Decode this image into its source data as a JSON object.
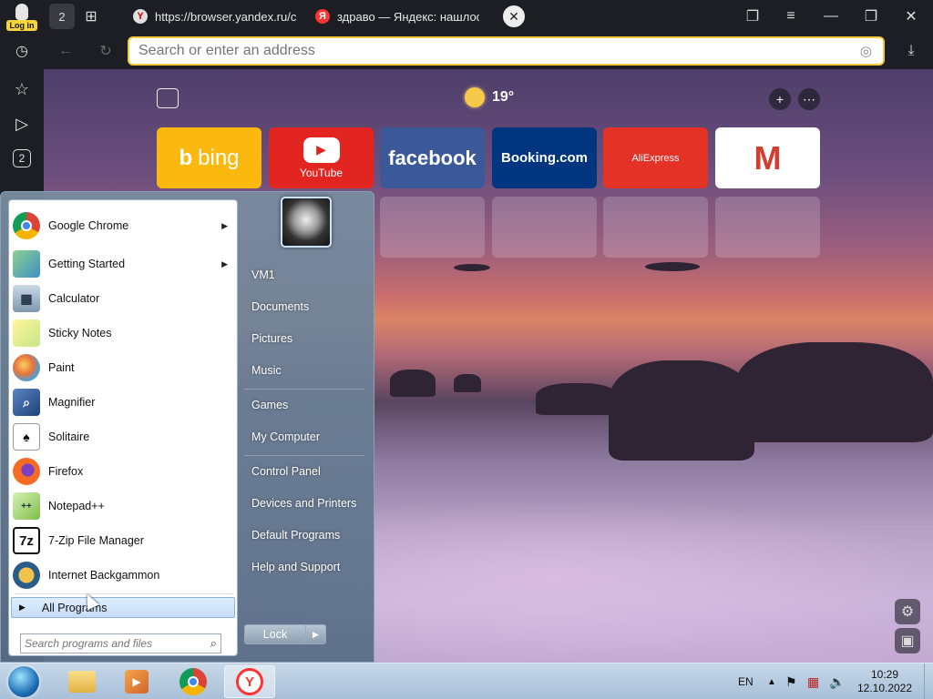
{
  "browser": {
    "login_label": "Log in",
    "tab_count": "2",
    "tabs": [
      {
        "label": "https://browser.yandex.ru/c"
      },
      {
        "label": "здраво — Яндекс: нашлос"
      }
    ],
    "address_placeholder": "Search or enter an address",
    "sidebar_badge": "2"
  },
  "newtab": {
    "temperature": "19°",
    "tiles": [
      {
        "label": "bing",
        "color": "#fbb80e"
      },
      {
        "label": "YouTube",
        "color": "#e22521"
      },
      {
        "label": "facebook",
        "color": "#3b5998"
      },
      {
        "label": "Booking.com",
        "color": "#003580"
      },
      {
        "label": "AliExpress",
        "color": "#e43226"
      },
      {
        "label": "M",
        "color": "#ffffff"
      }
    ]
  },
  "startmenu": {
    "apps": [
      {
        "label": "Google Chrome",
        "icon": "chrome-icon",
        "has_arrow": true
      },
      {
        "label": "Getting Started",
        "icon": "getting-started-icon",
        "has_arrow": true
      },
      {
        "label": "Calculator",
        "icon": "calculator-icon"
      },
      {
        "label": "Sticky Notes",
        "icon": "sticky-notes-icon"
      },
      {
        "label": "Paint",
        "icon": "paint-icon"
      },
      {
        "label": "Magnifier",
        "icon": "magnifier-icon"
      },
      {
        "label": "Solitaire",
        "icon": "solitaire-icon"
      },
      {
        "label": "Firefox",
        "icon": "firefox-icon"
      },
      {
        "label": "Notepad++",
        "icon": "notepad-plus-icon"
      },
      {
        "label": "7-Zip File Manager",
        "icon": "seven-zip-icon"
      },
      {
        "label": "Internet Backgammon",
        "icon": "backgammon-icon"
      }
    ],
    "all_programs": "All Programs",
    "search_placeholder": "Search programs and files",
    "right_items": [
      "VM1",
      "Documents",
      "Pictures",
      "Music",
      "Games",
      "My Computer",
      "Control Panel",
      "Devices and Printers",
      "Default Programs",
      "Help and Support"
    ],
    "lock_label": "Lock"
  },
  "taskbar": {
    "language": "EN",
    "time": "10:29",
    "date": "12.10.2022"
  }
}
